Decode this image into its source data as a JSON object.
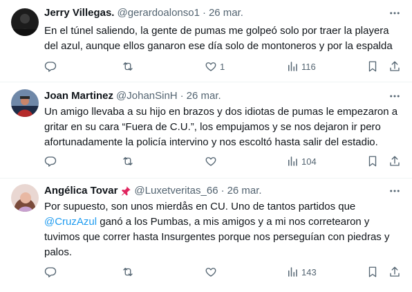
{
  "colors": {
    "text": "#0f1419",
    "muted": "#536471",
    "link": "#1d9bf0",
    "divider": "#eff3f4",
    "pin": "#e0245e"
  },
  "icons": [
    "more-icon",
    "reply-icon",
    "retweet-icon",
    "like-icon",
    "views-icon",
    "bookmark-icon",
    "share-icon",
    "pin-icon"
  ],
  "tweets": [
    {
      "name": "Jerry Villegas.",
      "handle": "@gerardoalonso1",
      "date": "26 mar.",
      "text": "En el túnel saliendo, la gente de pumas me golpeó solo por traer la playera\ndel azul, aunque ellos ganaron ese día solo de montoneros y por la espalda",
      "likes": "1",
      "views": "116"
    },
    {
      "name": "Joan Martinez",
      "handle": "@JohanSinH",
      "date": "26 mar.",
      "text": "Un amigo llevaba a su hijo en brazos y dos idiotas de pumas le empezaron a\ngritar en su cara “Fuera de C.U.”, los empujamos y se nos dejaron ir pero\nafortunadamente la policía intervino y nos escoltó hasta salir del estadio.",
      "likes": "",
      "views": "104"
    },
    {
      "name": "Angélica Tovar",
      "handle": "@Luxetveritas_66",
      "date": "26 mar.",
      "text_before": "Por supuesto, son unos mierdås en CU. Uno de tantos partidos que\n",
      "mention": "@CruzAzul",
      "text_after": " ganó a los Pumbas, a mis amigos y a mi nos corretearon y\ntuvimos que correr hasta Insurgentes porque nos perseguían con piedras y\npalos.",
      "likes": "",
      "views": "143"
    }
  ]
}
